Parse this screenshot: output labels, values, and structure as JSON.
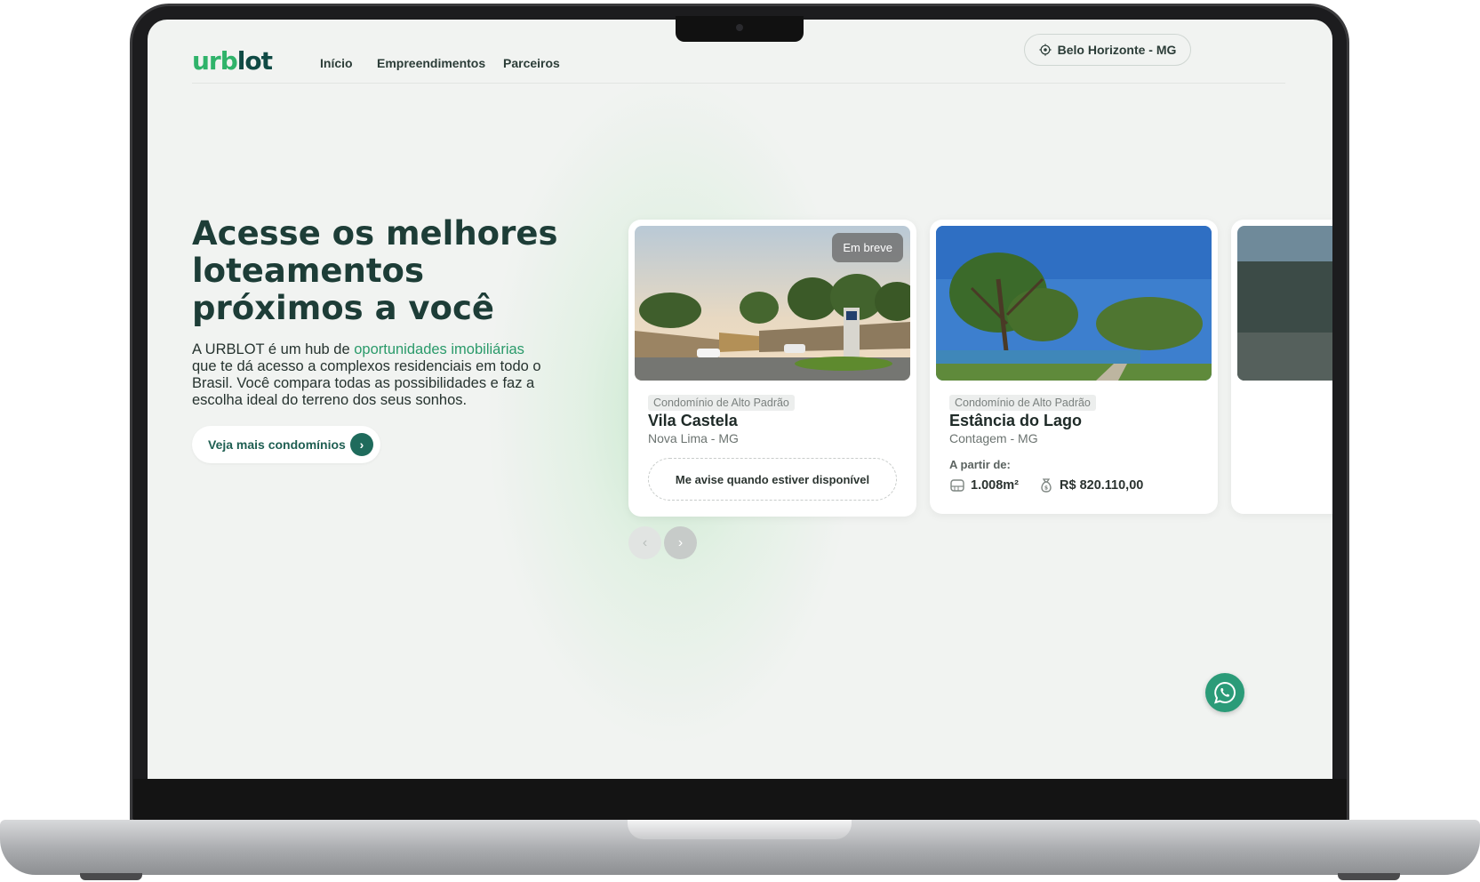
{
  "brand": {
    "logo_part1": "urb",
    "logo_part2": "lot"
  },
  "nav": {
    "links": [
      "Início",
      "Empreendimentos",
      "Parceiros"
    ],
    "location": "Belo Horizonte - MG"
  },
  "hero": {
    "title": "Acesse os melhores loteamentos próximos a você",
    "text_before": "A URBLOT é um hub de ",
    "text_highlight": "oportunidades imobiliárias",
    "text_after": " que te dá acesso a complexos residenciais em todo o Brasil. Você compara todas as possibilidades e faz a escolha ideal do terreno dos seus sonhos.",
    "cta": "Veja mais condomínios"
  },
  "cards": [
    {
      "tag": "Condomínio de Alto Padrão",
      "title": "Vila Castela",
      "location": "Nova Lima - MG",
      "badge": "Em breve",
      "notify": "Me avise quando estiver disponível"
    },
    {
      "tag": "Condomínio de Alto Padrão",
      "title": "Estância do Lago",
      "location": "Contagem - MG",
      "price_label": "A partir de:",
      "area": "1.008m²",
      "price": "R$ 820.110,00"
    }
  ],
  "colors": {
    "brand_green": "#2fb36a",
    "brand_dark": "#0f4a44",
    "accent": "#1f6b5c",
    "whatsapp": "#2b9b78"
  },
  "icons": [
    "location-target-icon",
    "chevron-right-icon",
    "ruler-area-icon",
    "money-bag-icon",
    "whatsapp-icon"
  ]
}
